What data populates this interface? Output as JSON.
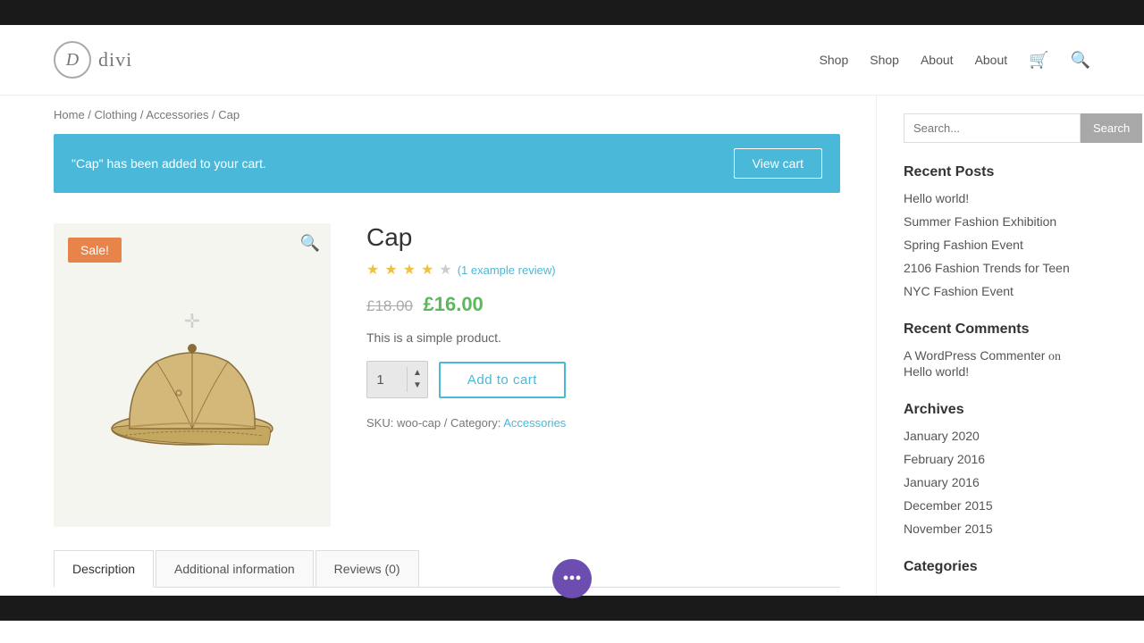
{
  "topBar": {},
  "header": {
    "logo": {
      "letter": "D",
      "text": "divi"
    },
    "nav": [
      {
        "label": "Shop",
        "href": "#"
      },
      {
        "label": "Shop",
        "href": "#"
      },
      {
        "label": "About",
        "href": "#"
      },
      {
        "label": "About",
        "href": "#"
      }
    ],
    "cart_icon": "🛒",
    "search_icon": "🔍"
  },
  "breadcrumb": {
    "items": [
      "Home",
      "Clothing",
      "Accessories",
      "Cap"
    ],
    "separators": " / "
  },
  "notification": {
    "message": "\"Cap\" has been added to your cart.",
    "button_label": "View cart"
  },
  "product": {
    "title": "Cap",
    "stars": 3.5,
    "review_text": "(1 example review)",
    "original_price": "£18.00",
    "sale_price": "£16.00",
    "description": "This is a simple product.",
    "quantity": "1",
    "add_to_cart_label": "Add to cart",
    "sku": "woo-cap",
    "category": "Accessories",
    "sale_badge": "Sale!"
  },
  "tabs": [
    {
      "label": "Description",
      "active": true
    },
    {
      "label": "Additional information",
      "active": false
    },
    {
      "label": "Reviews (0)",
      "active": false
    }
  ],
  "sidebar": {
    "search_placeholder": "Search...",
    "search_button": "Search",
    "recent_posts_title": "Recent Posts",
    "recent_posts": [
      {
        "label": "Hello world!"
      },
      {
        "label": "Summer Fashion Exhibition"
      },
      {
        "label": "Spring Fashion Event"
      },
      {
        "label": "2106 Fashion Trends for Teen"
      },
      {
        "label": "NYC Fashion Event"
      }
    ],
    "recent_comments_title": "Recent Comments",
    "recent_comments": [
      {
        "author": "A WordPress Commenter",
        "on": "on",
        "post": "Hello world!"
      }
    ],
    "archives_title": "Archives",
    "archives": [
      {
        "label": "January 2020"
      },
      {
        "label": "February 2016"
      },
      {
        "label": "January 2016"
      },
      {
        "label": "December 2015"
      },
      {
        "label": "November 2015"
      }
    ],
    "categories_title": "Categories"
  },
  "fab": {
    "icon": "•••"
  }
}
